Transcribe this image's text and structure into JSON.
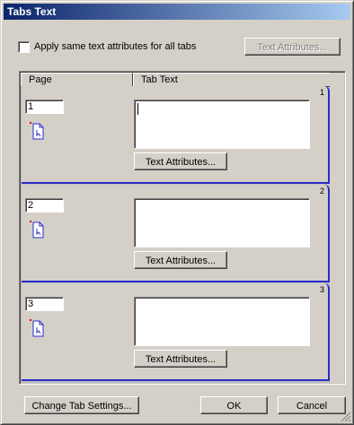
{
  "window": {
    "title": "Tabs Text"
  },
  "top": {
    "apply_same_label": "Apply same text attributes for all tabs",
    "text_attributes_label": "Text Attributes..."
  },
  "list": {
    "columns": [
      "Page",
      "Tab Text"
    ],
    "tabs": [
      {
        "tab_number": "1",
        "page": "1",
        "button_label": "Text Attributes..."
      },
      {
        "tab_number": "2",
        "page": "2",
        "button_label": "Text Attributes..."
      },
      {
        "tab_number": "3",
        "page": "3",
        "button_label": "Text Attributes..."
      }
    ]
  },
  "bottom": {
    "change_tab_settings": "Change Tab Settings...",
    "ok": "OK",
    "cancel": "Cancel"
  },
  "colors": {
    "tab_border": "#2a2ac8",
    "title_start": "#0a246a",
    "title_end": "#a6caf0"
  }
}
